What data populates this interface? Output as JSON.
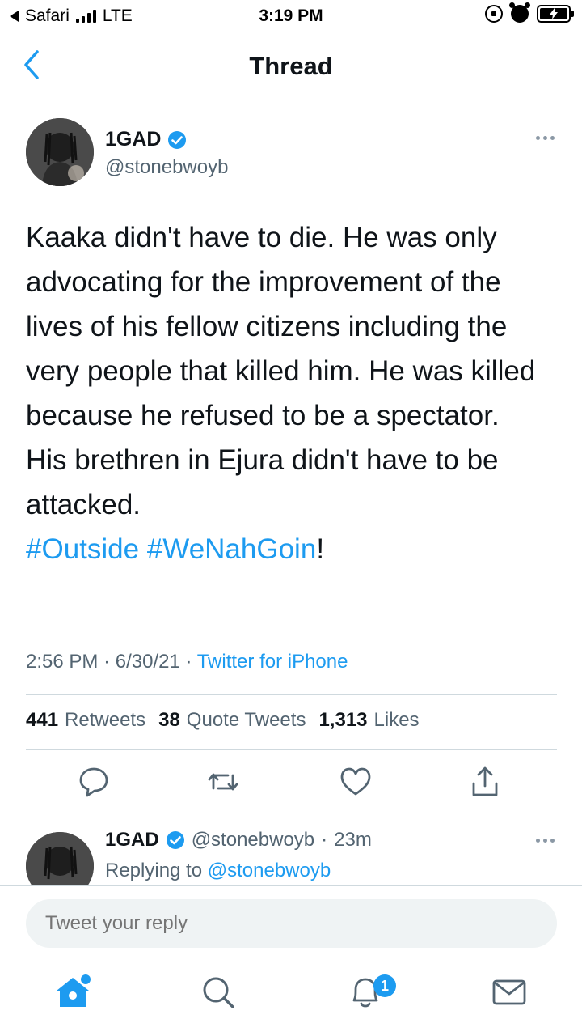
{
  "status_bar": {
    "carrier": "Safari",
    "network": "LTE",
    "time": "3:19 PM"
  },
  "nav": {
    "title": "Thread"
  },
  "tweet": {
    "author_name": "1GAD",
    "author_handle": "@stonebwoyb",
    "text_lines": [
      "Kaaka didn't have to die. He was only advocating for the improvement of the lives of his fellow citizens including the very people that killed him. He was killed because he refused to be a spectator.",
      "His brethren in Ejura didn't have to be attacked."
    ],
    "hashtags": [
      "#Outside",
      "#WeNahGoin"
    ],
    "hashtag_suffix": "!",
    "time": "2:56 PM",
    "date": "6/30/21",
    "meta_sep": "·",
    "source": "Twitter for iPhone",
    "stats": {
      "retweets_count": "441",
      "retweets_label": "Retweets",
      "quotes_count": "38",
      "quotes_label": "Quote Tweets",
      "likes_count": "1,313",
      "likes_label": "Likes"
    }
  },
  "reply": {
    "author_name": "1GAD",
    "author_handle": "@stonebwoyb",
    "sep": "·",
    "age": "23m",
    "replying_label": "Replying to",
    "replying_handle": "@stonebwoyb"
  },
  "compose": {
    "placeholder": "Tweet your reply"
  },
  "tabbar": {
    "notifications_badge": "1"
  },
  "colors": {
    "accent": "#1d9bf0",
    "text": "#0f1419",
    "secondary": "#536471",
    "divider": "#cfd9de"
  }
}
